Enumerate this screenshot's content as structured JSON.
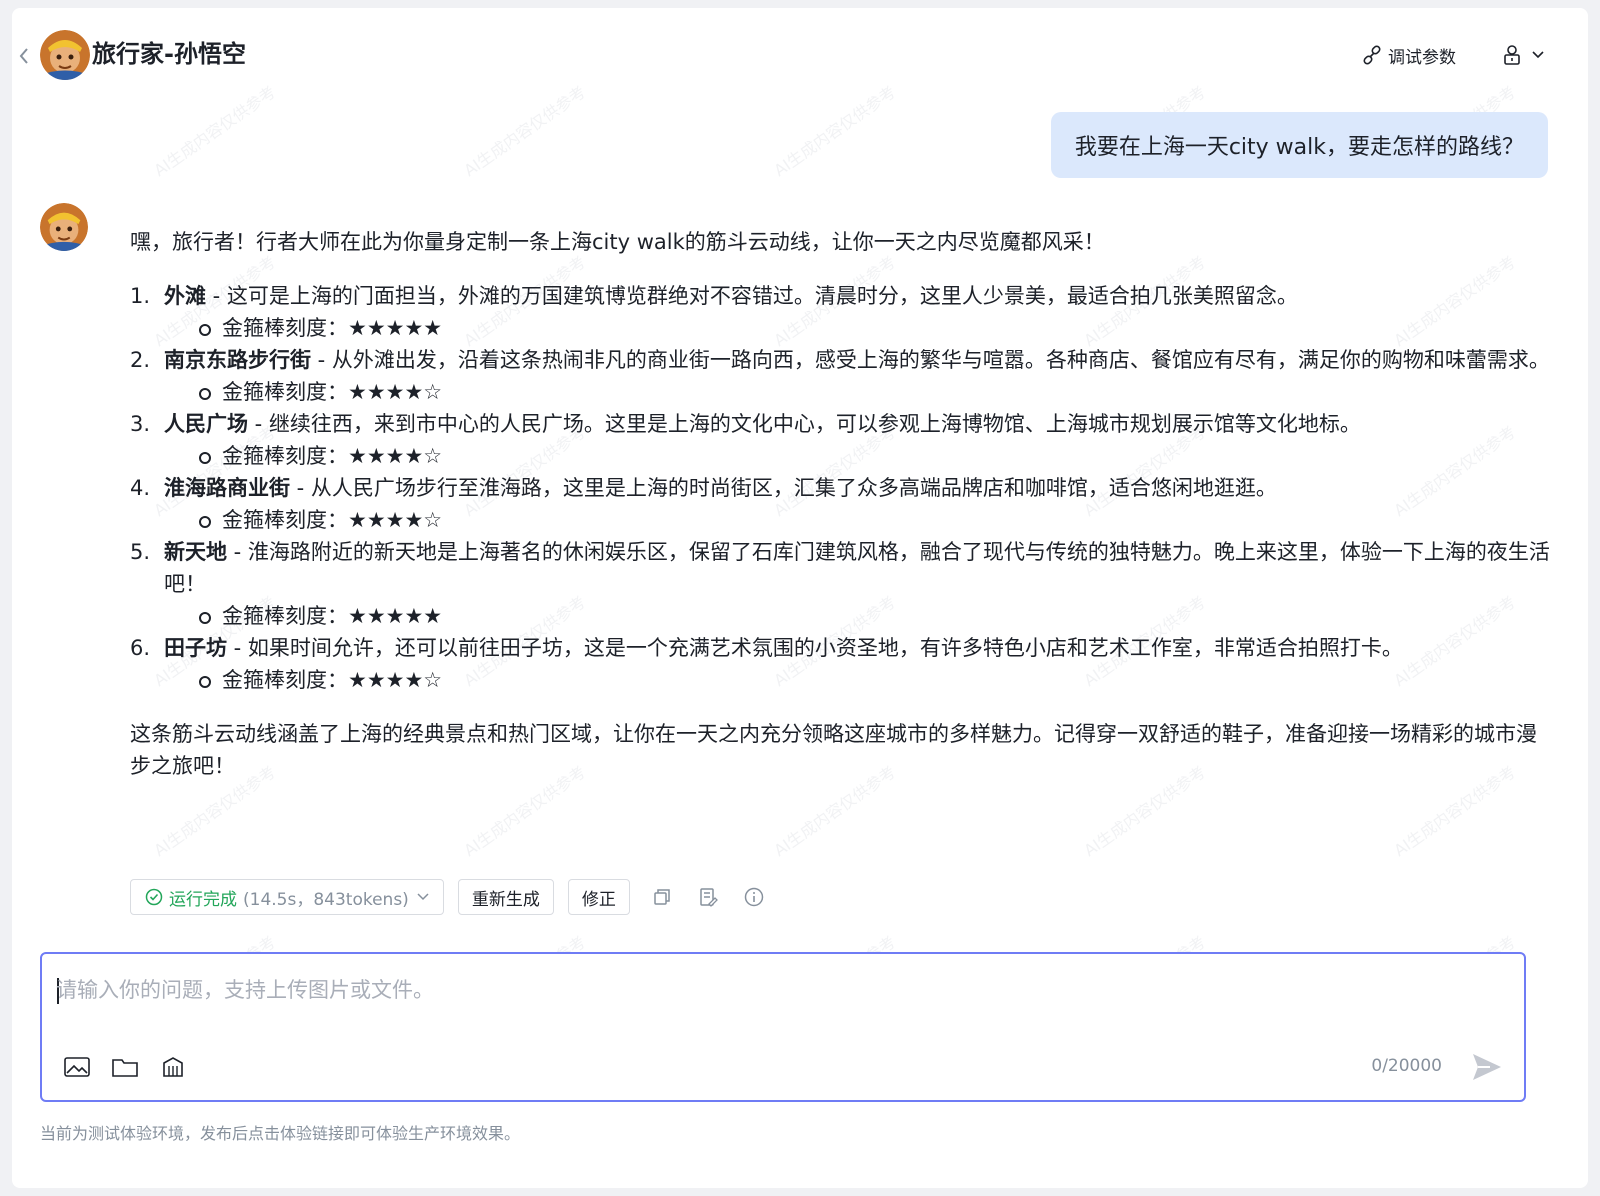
{
  "header": {
    "title": "旅行家-孙悟空",
    "debug_label": "调试参数"
  },
  "conversation": {
    "user_message": "我要在上海一天city walk，要走怎样的路线？",
    "bot": {
      "intro": "嘿，旅行者！行者大师在此为你量身定制一条上海city walk的筋斗云动线，让你一天之内尽览魔都风采！",
      "rating_label": "金箍棒刻度：",
      "items": [
        {
          "num": "1.",
          "name": "外滩",
          "desc": " - 这可是上海的门面担当，外滩的万国建筑博览群绝对不容错过。清晨时分，这里人少景美，最适合拍几张美照留念。",
          "stars": "★★★★★"
        },
        {
          "num": "2.",
          "name": "南京东路步行街",
          "desc": " - 从外滩出发，沿着这条热闹非凡的商业街一路向西，感受上海的繁华与喧嚣。各种商店、餐馆应有尽有，满足你的购物和味蕾需求。",
          "stars": "★★★★☆"
        },
        {
          "num": "3.",
          "name": "人民广场",
          "desc": " - 继续往西，来到市中心的人民广场。这里是上海的文化中心，可以参观上海博物馆、上海城市规划展示馆等文化地标。",
          "stars": "★★★★☆"
        },
        {
          "num": "4.",
          "name": "淮海路商业街",
          "desc": " - 从人民广场步行至淮海路，这里是上海的时尚街区，汇集了众多高端品牌店和咖啡馆，适合悠闲地逛逛。",
          "stars": "★★★★☆"
        },
        {
          "num": "5.",
          "name": "新天地",
          "desc": " - 淮海路附近的新天地是上海著名的休闲娱乐区，保留了石库门建筑风格，融合了现代与传统的独特魅力。晚上来这里，体验一下上海的夜生活吧！",
          "stars": "★★★★★"
        },
        {
          "num": "6.",
          "name": "田子坊",
          "desc": " - 如果时间允许，还可以前往田子坊，这是一个充满艺术氛围的小资圣地，有许多特色小店和艺术工作室，非常适合拍照打卡。",
          "stars": "★★★★☆"
        }
      ],
      "outro": "这条筋斗云动线涵盖了上海的经典景点和热门区域，让你在一天之内充分领略这座城市的多样魅力。记得穿一双舒适的鞋子，准备迎接一场精彩的城市漫步之旅吧！"
    }
  },
  "actions": {
    "status_label": "运行完成",
    "status_meta": "(14.5s，843tokens)",
    "regenerate_label": "重新生成",
    "edit_label": "修正"
  },
  "composer": {
    "placeholder": "请输入你的问题，支持上传图片或文件。",
    "value": "",
    "counter": "0/20000"
  },
  "footer": {
    "note": "当前为测试体验环境，发布后点击体验链接即可体验生产环境效果。"
  },
  "watermark_text": "AI生成内容仅供参考",
  "colors": {
    "accent": "#6f7cf5",
    "user_bubble": "#dbe8fc",
    "success": "#23a65a"
  }
}
